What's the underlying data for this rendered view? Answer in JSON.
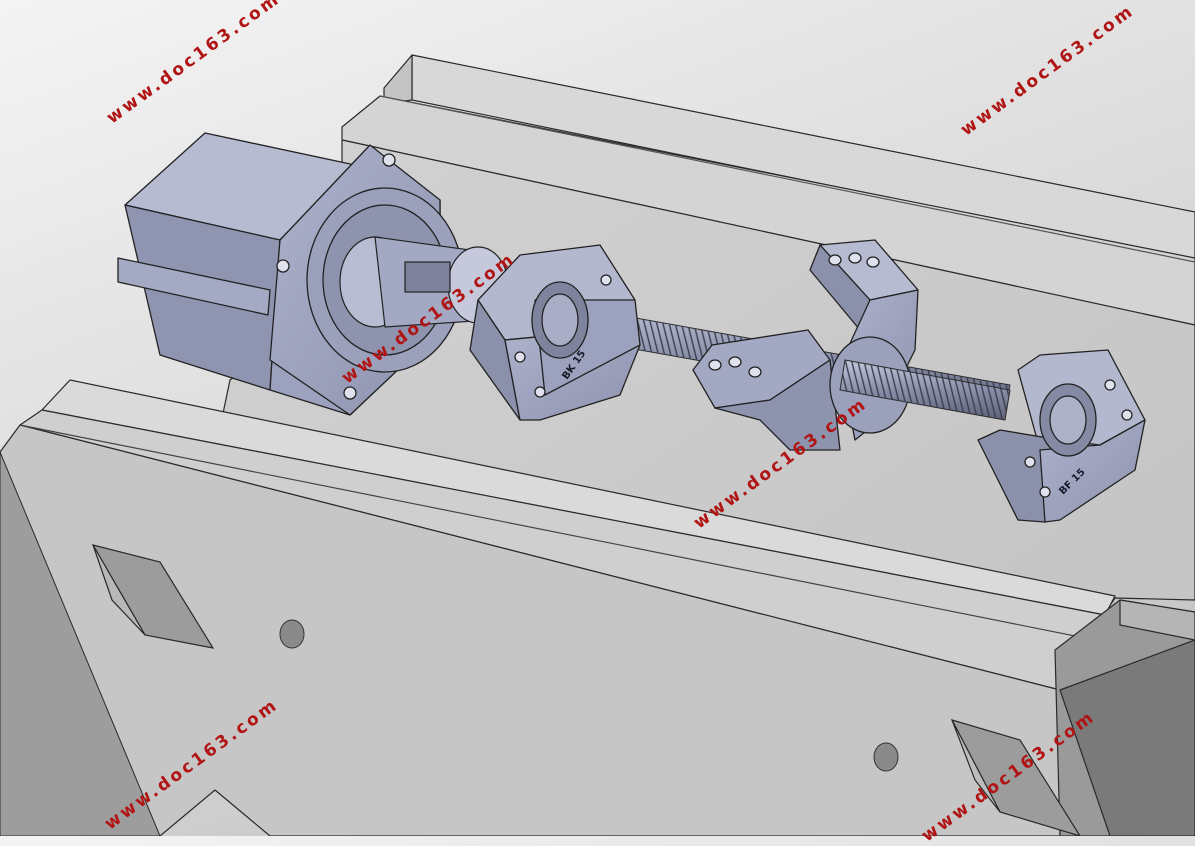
{
  "viewport": {
    "background_top": "#f4f4f4",
    "background_bottom": "#bdbdbd",
    "part_color": "#9aa0bc",
    "base_color": "#c9c9c9",
    "edge_color": "#2a2a2a"
  },
  "watermarks": [
    {
      "text": "www.doc163.com"
    },
    {
      "text": "www.doc163.com"
    },
    {
      "text": "www.doc163.com"
    },
    {
      "text": "www.doc163.com"
    },
    {
      "text": "www.doc163.com"
    },
    {
      "text": "www.doc163.com"
    },
    {
      "text": "www.doc163.com"
    }
  ],
  "part_markings": {
    "bearing_block_left": "BK 15",
    "bearing_block_right": "BF 15"
  }
}
